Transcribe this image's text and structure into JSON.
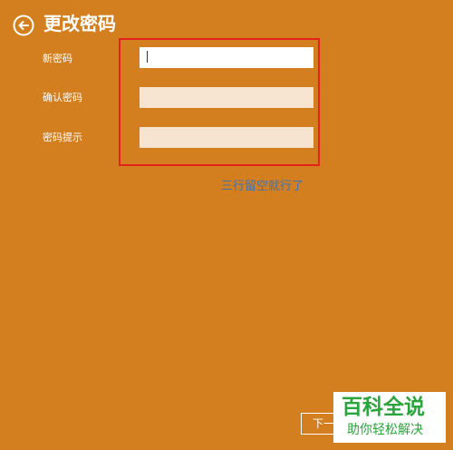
{
  "header": {
    "title": "更改密码",
    "back_icon": "circle-arrow-left-icon"
  },
  "form": {
    "fields": [
      {
        "label": "新密码",
        "value": ""
      },
      {
        "label": "确认密码",
        "value": ""
      },
      {
        "label": "密码提示",
        "value": ""
      }
    ]
  },
  "annotation": {
    "text": "三行留空就行了"
  },
  "footer": {
    "next_label": "下一"
  },
  "watermark": {
    "main_text": "百科全说",
    "sub_text": "助你轻松解决"
  },
  "colors": {
    "background": "#d47f1f",
    "highlight_border": "#e3231b",
    "annotation_text": "#3d72b5",
    "watermark_text": "#2aa53b"
  }
}
